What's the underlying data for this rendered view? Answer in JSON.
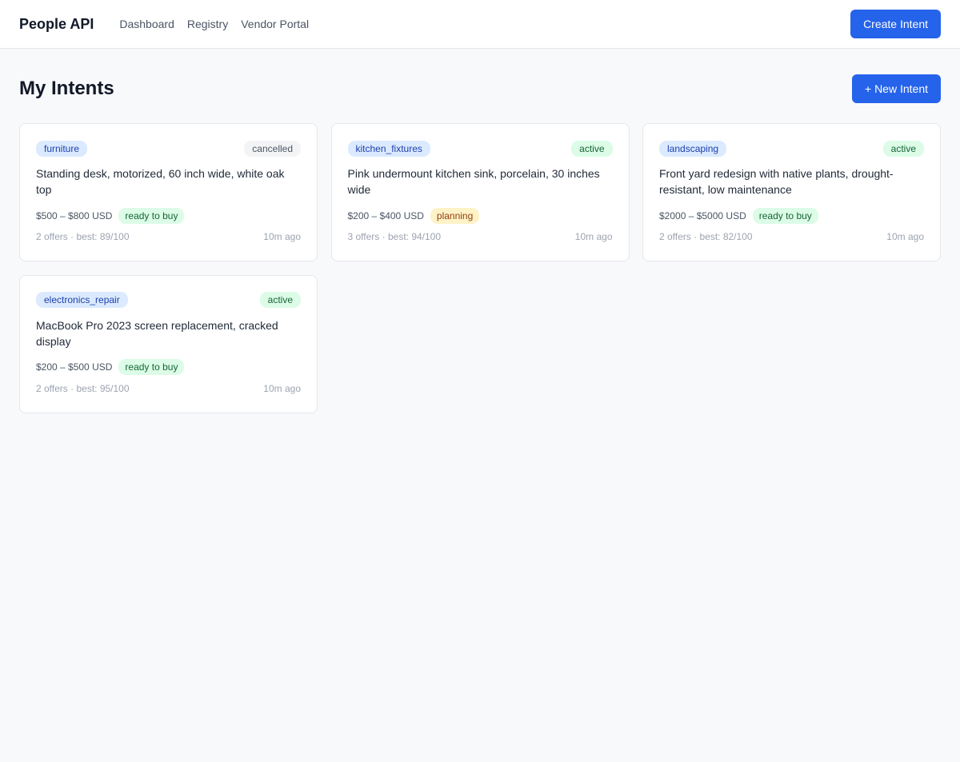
{
  "header": {
    "brand": "People API",
    "nav": [
      "Dashboard",
      "Registry",
      "Vendor Portal"
    ],
    "create_button": "Create Intent"
  },
  "page": {
    "title": "My Intents",
    "new_button": "+ New Intent"
  },
  "colors": {
    "accent": "#2563eb",
    "category_bg": "#dbeafe",
    "active_bg": "#dcfce7",
    "planning_bg": "#fef3c7",
    "cancelled_bg": "#f3f4f6"
  },
  "intents": [
    {
      "category": "furniture",
      "status": "cancelled",
      "description": "Standing desk, motorized, 60 inch wide, white oak top",
      "price": "$500 – $800 USD",
      "stage": "ready to buy",
      "offers": "2 offers · best: 89/100",
      "time": "10m ago"
    },
    {
      "category": "kitchen_fixtures",
      "status": "active",
      "description": "Pink undermount kitchen sink, porcelain, 30 inches wide",
      "price": "$200 – $400 USD",
      "stage": "planning",
      "offers": "3 offers · best: 94/100",
      "time": "10m ago"
    },
    {
      "category": "landscaping",
      "status": "active",
      "description": "Front yard redesign with native plants, drought-resistant, low maintenance",
      "price": "$2000 – $5000 USD",
      "stage": "ready to buy",
      "offers": "2 offers · best: 82/100",
      "time": "10m ago"
    },
    {
      "category": "electronics_repair",
      "status": "active",
      "description": "MacBook Pro 2023 screen replacement, cracked display",
      "price": "$200 – $500 USD",
      "stage": "ready to buy",
      "offers": "2 offers · best: 95/100",
      "time": "10m ago"
    }
  ]
}
